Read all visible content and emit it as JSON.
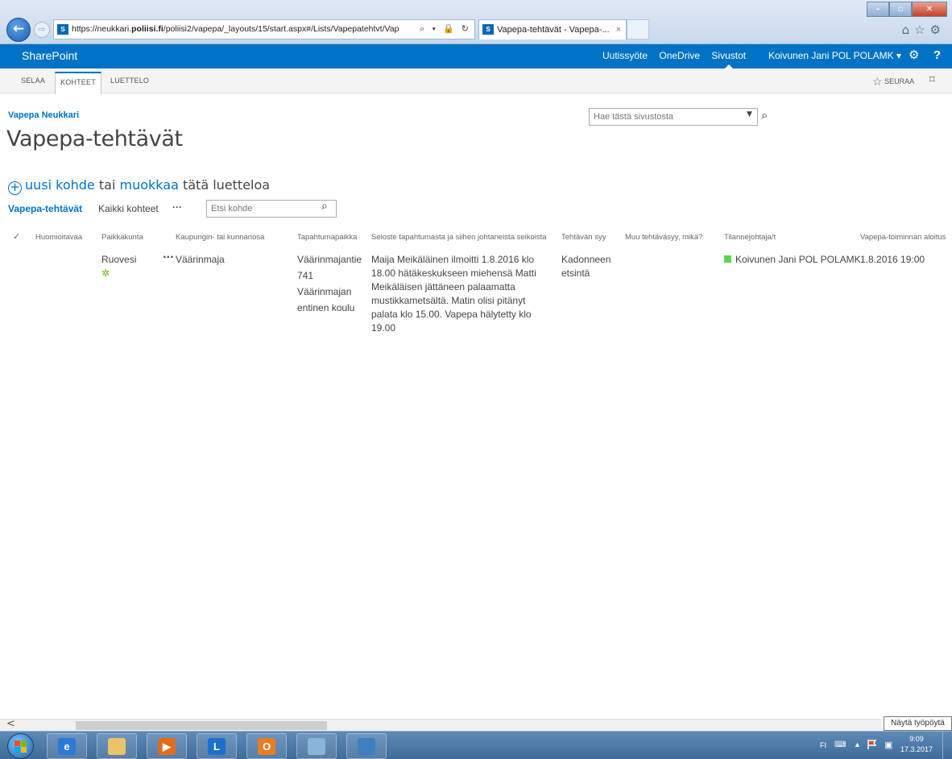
{
  "browser": {
    "url_prefix": "https://neukkari.",
    "url_domain": "poliisi.fi",
    "url_rest": "/poliisi2/vapepa/_layouts/15/start.aspx#/Lists/Vapepatehtvt/Vap",
    "url_controls": "⌕ ▾ 🔒 ↻",
    "tab_title": "Vapepa-tehtävät - Vapepa-...",
    "tab_close": "×",
    "favicon_label": "S"
  },
  "suite": {
    "brand": "SharePoint",
    "links": [
      "Uutissyöte",
      "OneDrive",
      "Sivustot"
    ],
    "active_link_index": 2,
    "user": "Koivunen Jani POL POLAMK ▾",
    "help": "?"
  },
  "ribbon": {
    "tabs": [
      "SELAA",
      "KOHTEET",
      "LUETTELO"
    ],
    "selected_tab_index": 1,
    "follow": "SEURAA"
  },
  "page": {
    "site_title": "Vapepa Neukkari",
    "title": "Vapepa-tehtävät",
    "site_search_placeholder": "Hae tästä sivustosta",
    "new_item_link": "uusi kohde",
    "new_item_or": "tai",
    "edit_link": "muokkaa",
    "edit_rest": "tätä luetteloa"
  },
  "views": {
    "current": "Vapepa-tehtävät",
    "other": "Kaikki kohteet",
    "more": "···",
    "search_placeholder": "Etsi kohde"
  },
  "table": {
    "check": "✓",
    "columns": [
      "Huomioitavaa",
      "Paikkakunta",
      "Kaupungin- tai kunnanosa",
      "Tapahtumapaikka",
      "Seloste tapahtumasta ja siihen johtaneista seikoista",
      "Tehtävän syy",
      "Muu tehtäväsyy, mikä?",
      "Tilannejohtaja/t",
      "Vapepa-toiminnan aloitus"
    ],
    "rows": [
      {
        "huomioitavaa": "",
        "paikkakunta": "Ruovesi",
        "new_marker": "✲",
        "row_menu": "···",
        "kunnanosa": "Väärinmaja",
        "tapahtumapaikka": "Väärinmajantie 741 Väärinmajan entinen koulu",
        "seloste": "Maija Meikäläinen ilmoitti 1.8.2016 klo 18.00 hätäkeskukseen miehensä Matti Meikäläisen jättäneen palaamatta mustikkametsältä. Matin olisi pitänyt palata klo 15.00. Vapepa hälytetty klo 19.00",
        "syy": "Kadonneen etsintä",
        "muu_syy": "",
        "tilannejohtaja": "Koivunen Jani POL POLAMK",
        "aloitus": "1.8.2016 19:00"
      }
    ]
  },
  "statusbar": {
    "scroll_left": "<",
    "tooltip": "Näytä työpöytä"
  },
  "taskbar": {
    "apps": [
      {
        "icon": "internet-explorer-icon",
        "glyph": "e",
        "color": "#2b7ad6"
      },
      {
        "icon": "file-explorer-icon",
        "glyph": "",
        "color": "#e9c46a"
      },
      {
        "icon": "media-player-icon",
        "glyph": "▶",
        "color": "#e06b1d"
      },
      {
        "icon": "lync-icon",
        "glyph": "L",
        "color": "#1e6fd0"
      },
      {
        "icon": "outlook-icon",
        "glyph": "O",
        "color": "#e67e22"
      },
      {
        "icon": "paint-icon",
        "glyph": "",
        "color": "#8ab4d8"
      },
      {
        "icon": "photo-viewer-icon",
        "glyph": "",
        "color": "#3f7fbf"
      }
    ],
    "lang": "FI",
    "time": "9:09",
    "date": "17.3.2017"
  }
}
